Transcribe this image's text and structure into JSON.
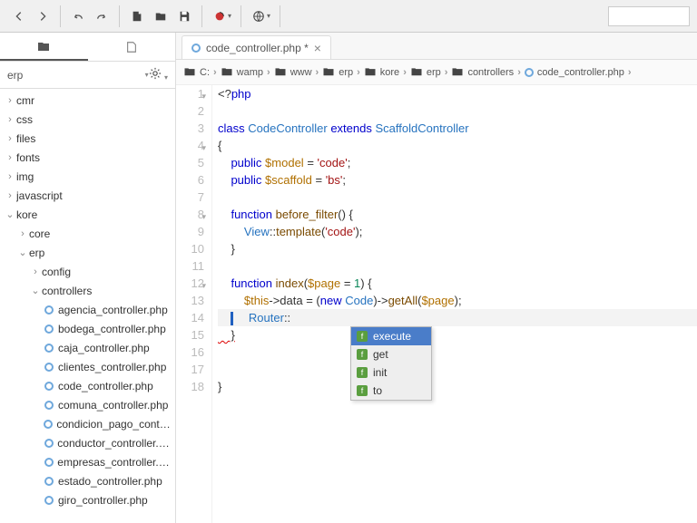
{
  "toolbar": {
    "search_placeholder": ""
  },
  "sidebar": {
    "project_label": "erp",
    "folders": [
      {
        "label": "cmr",
        "depth": 0,
        "open": false
      },
      {
        "label": "css",
        "depth": 0,
        "open": false
      },
      {
        "label": "files",
        "depth": 0,
        "open": false
      },
      {
        "label": "fonts",
        "depth": 0,
        "open": false
      },
      {
        "label": "img",
        "depth": 0,
        "open": false
      },
      {
        "label": "javascript",
        "depth": 0,
        "open": false
      },
      {
        "label": "kore",
        "depth": 0,
        "open": true
      },
      {
        "label": "core",
        "depth": 1,
        "open": false
      },
      {
        "label": "erp",
        "depth": 1,
        "open": true
      },
      {
        "label": "config",
        "depth": 2,
        "open": false
      },
      {
        "label": "controllers",
        "depth": 2,
        "open": true
      }
    ],
    "files": [
      "agencia_controller.php",
      "bodega_controller.php",
      "caja_controller.php",
      "clientes_controller.php",
      "code_controller.php",
      "comuna_controller.php",
      "condicion_pago_controll…",
      "conductor_controller.php",
      "empresas_controller.php",
      "estado_controller.php",
      "giro_controller.php"
    ]
  },
  "tabs": {
    "active": "code_controller.php *"
  },
  "breadcrumb": [
    "C:",
    "wamp",
    "www",
    "erp",
    "kore",
    "erp",
    "controllers",
    "code_controller.php"
  ],
  "code": {
    "lines": [
      {
        "n": 1,
        "fold": "down",
        "html": "<span class='op'>&lt;?</span><span class='kw'>php</span>"
      },
      {
        "n": 2,
        "html": ""
      },
      {
        "n": 3,
        "html": "<span class='kw'>class</span> <span class='cls'>CodeController</span> <span class='kw'>extends</span> <span class='cls'>ScaffoldController</span>"
      },
      {
        "n": 4,
        "fold": "down",
        "html": "<span class='op'>{</span>"
      },
      {
        "n": 5,
        "html": "    <span class='kw'>public</span> <span class='var'>$model</span> <span class='op'>=</span> <span class='str'>'code'</span><span class='op'>;</span>"
      },
      {
        "n": 6,
        "html": "    <span class='kw'>public</span> <span class='var'>$scaffold</span> <span class='op'>=</span> <span class='str'>'bs'</span><span class='op'>;</span>"
      },
      {
        "n": 7,
        "html": ""
      },
      {
        "n": 8,
        "fold": "down",
        "html": "    <span class='kw'>function</span> <span class='fn'>before_filter</span><span class='op'>() {</span>"
      },
      {
        "n": 9,
        "html": "        <span class='cls'>View</span><span class='op'>::</span><span class='fn'>template</span><span class='op'>(</span><span class='str'>'code'</span><span class='op'>);</span>"
      },
      {
        "n": 10,
        "html": "    <span class='op'>}</span>"
      },
      {
        "n": 11,
        "html": ""
      },
      {
        "n": 12,
        "fold": "down",
        "html": "    <span class='kw'>function</span> <span class='fn'>index</span><span class='op'>(</span><span class='var'>$page</span> <span class='op'>=</span> <span class='num'>1</span><span class='op'>) {</span>"
      },
      {
        "n": 13,
        "html": "        <span class='var'>$this</span><span class='op'>-&gt;</span>data <span class='op'>= (</span><span class='kw'>new</span> <span class='cls'>Code</span><span class='op'>)-&gt;</span><span class='fn'>getAll</span><span class='op'>(</span><span class='var'>$page</span><span class='op'>);</span>"
      },
      {
        "n": 14,
        "hl": true,
        "html": "    <span class='cursor-mark'></span>    <span class='cls'>Router</span><span class='op'>::</span>"
      },
      {
        "n": 15,
        "html": "<span class='err-underline'>    }</span>"
      },
      {
        "n": 16,
        "html": ""
      },
      {
        "n": 17,
        "html": ""
      },
      {
        "n": 18,
        "html": "<span class='op'>}</span>"
      }
    ]
  },
  "autocomplete": {
    "items": [
      "execute",
      "get",
      "init",
      "to"
    ],
    "selected": 0
  }
}
